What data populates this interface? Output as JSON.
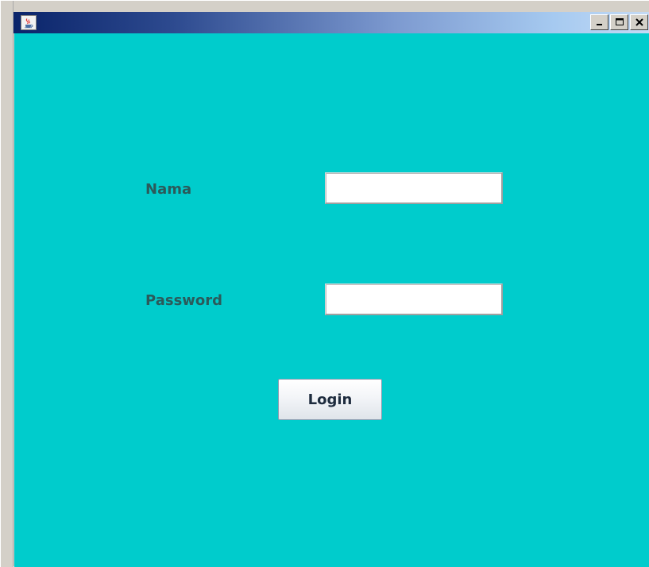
{
  "window": {
    "title": "",
    "icon": "java-coffee-icon",
    "controls": {
      "minimize_icon": "minimize-icon",
      "maximize_icon": "maximize-icon",
      "close_icon": "close-icon"
    }
  },
  "form": {
    "background_color": "#00cccc",
    "nama_label": "Nama",
    "nama_value": "",
    "password_label": "Password",
    "password_value": "",
    "login_label": "Login"
  }
}
